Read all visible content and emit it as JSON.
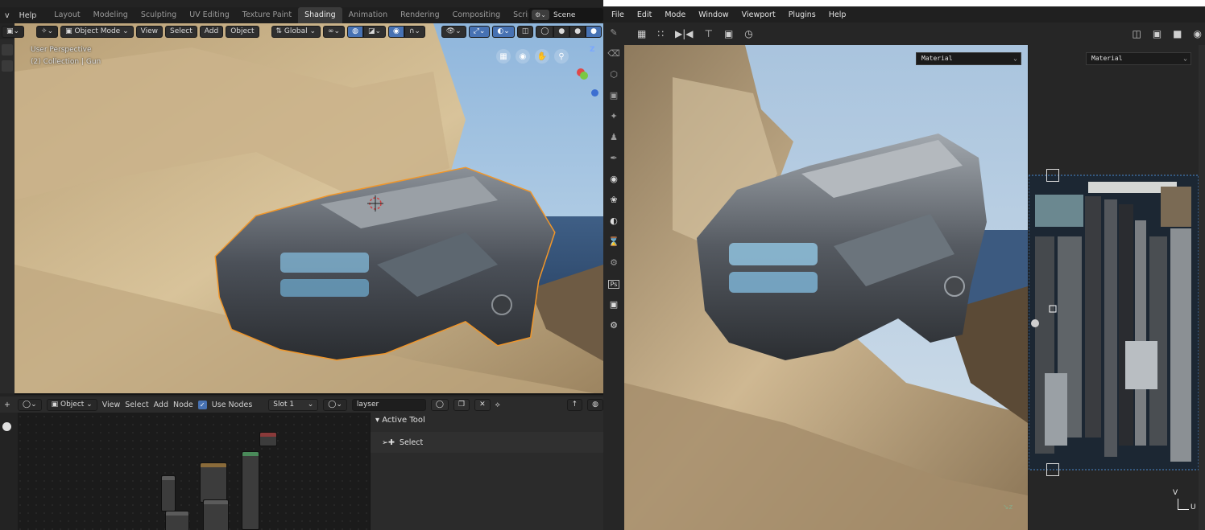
{
  "blender": {
    "topbar": {
      "menus": [
        "v",
        "Help"
      ],
      "tabs": [
        "Layout",
        "Modeling",
        "Sculpting",
        "UV Editing",
        "Texture Paint",
        "Shading",
        "Animation",
        "Rendering",
        "Compositing",
        "Scripting"
      ],
      "active_tab": "Shading",
      "scene_label": "Scene"
    },
    "viewport": {
      "mode": "Object Mode",
      "menus": [
        "View",
        "Select",
        "Add",
        "Object"
      ],
      "transform_orientation": "Global",
      "overlay_line1": "User Perspective",
      "overlay_line2": "(2) Collection | Gun",
      "gizmo_z": "Z"
    },
    "node_editor": {
      "editor_type": "Object",
      "menus": [
        "View",
        "Select",
        "Add",
        "Node"
      ],
      "use_nodes_label": "Use Nodes",
      "slot": "Slot 1",
      "material_name": "layser"
    },
    "properties": {
      "panel_title": "Active Tool",
      "tool": "Select"
    }
  },
  "painter": {
    "menus": [
      "File",
      "Edit",
      "Mode",
      "Window",
      "Viewport",
      "Plugins",
      "Help"
    ],
    "viewport_3d_channel": "Material",
    "viewport_2d_channel": "Material",
    "left_tools": [
      "brush-icon",
      "eraser-icon",
      "projection-icon",
      "geometry-mask-icon",
      "smudge-icon",
      "clone-icon",
      "picker-icon",
      "substance-icon",
      "render-icon",
      "share-icon",
      "hourglass-icon",
      "gear-icon",
      "ps-icon",
      "camera-icon",
      "settings-icon"
    ],
    "left_ps_label": "Ps",
    "uv_axis_v": "V",
    "uv_axis_u": "U"
  },
  "colors": {
    "blender_active_blue": "#4772b3",
    "selection_outline": "#f0962a",
    "background_dark": "#1d1d1d"
  }
}
